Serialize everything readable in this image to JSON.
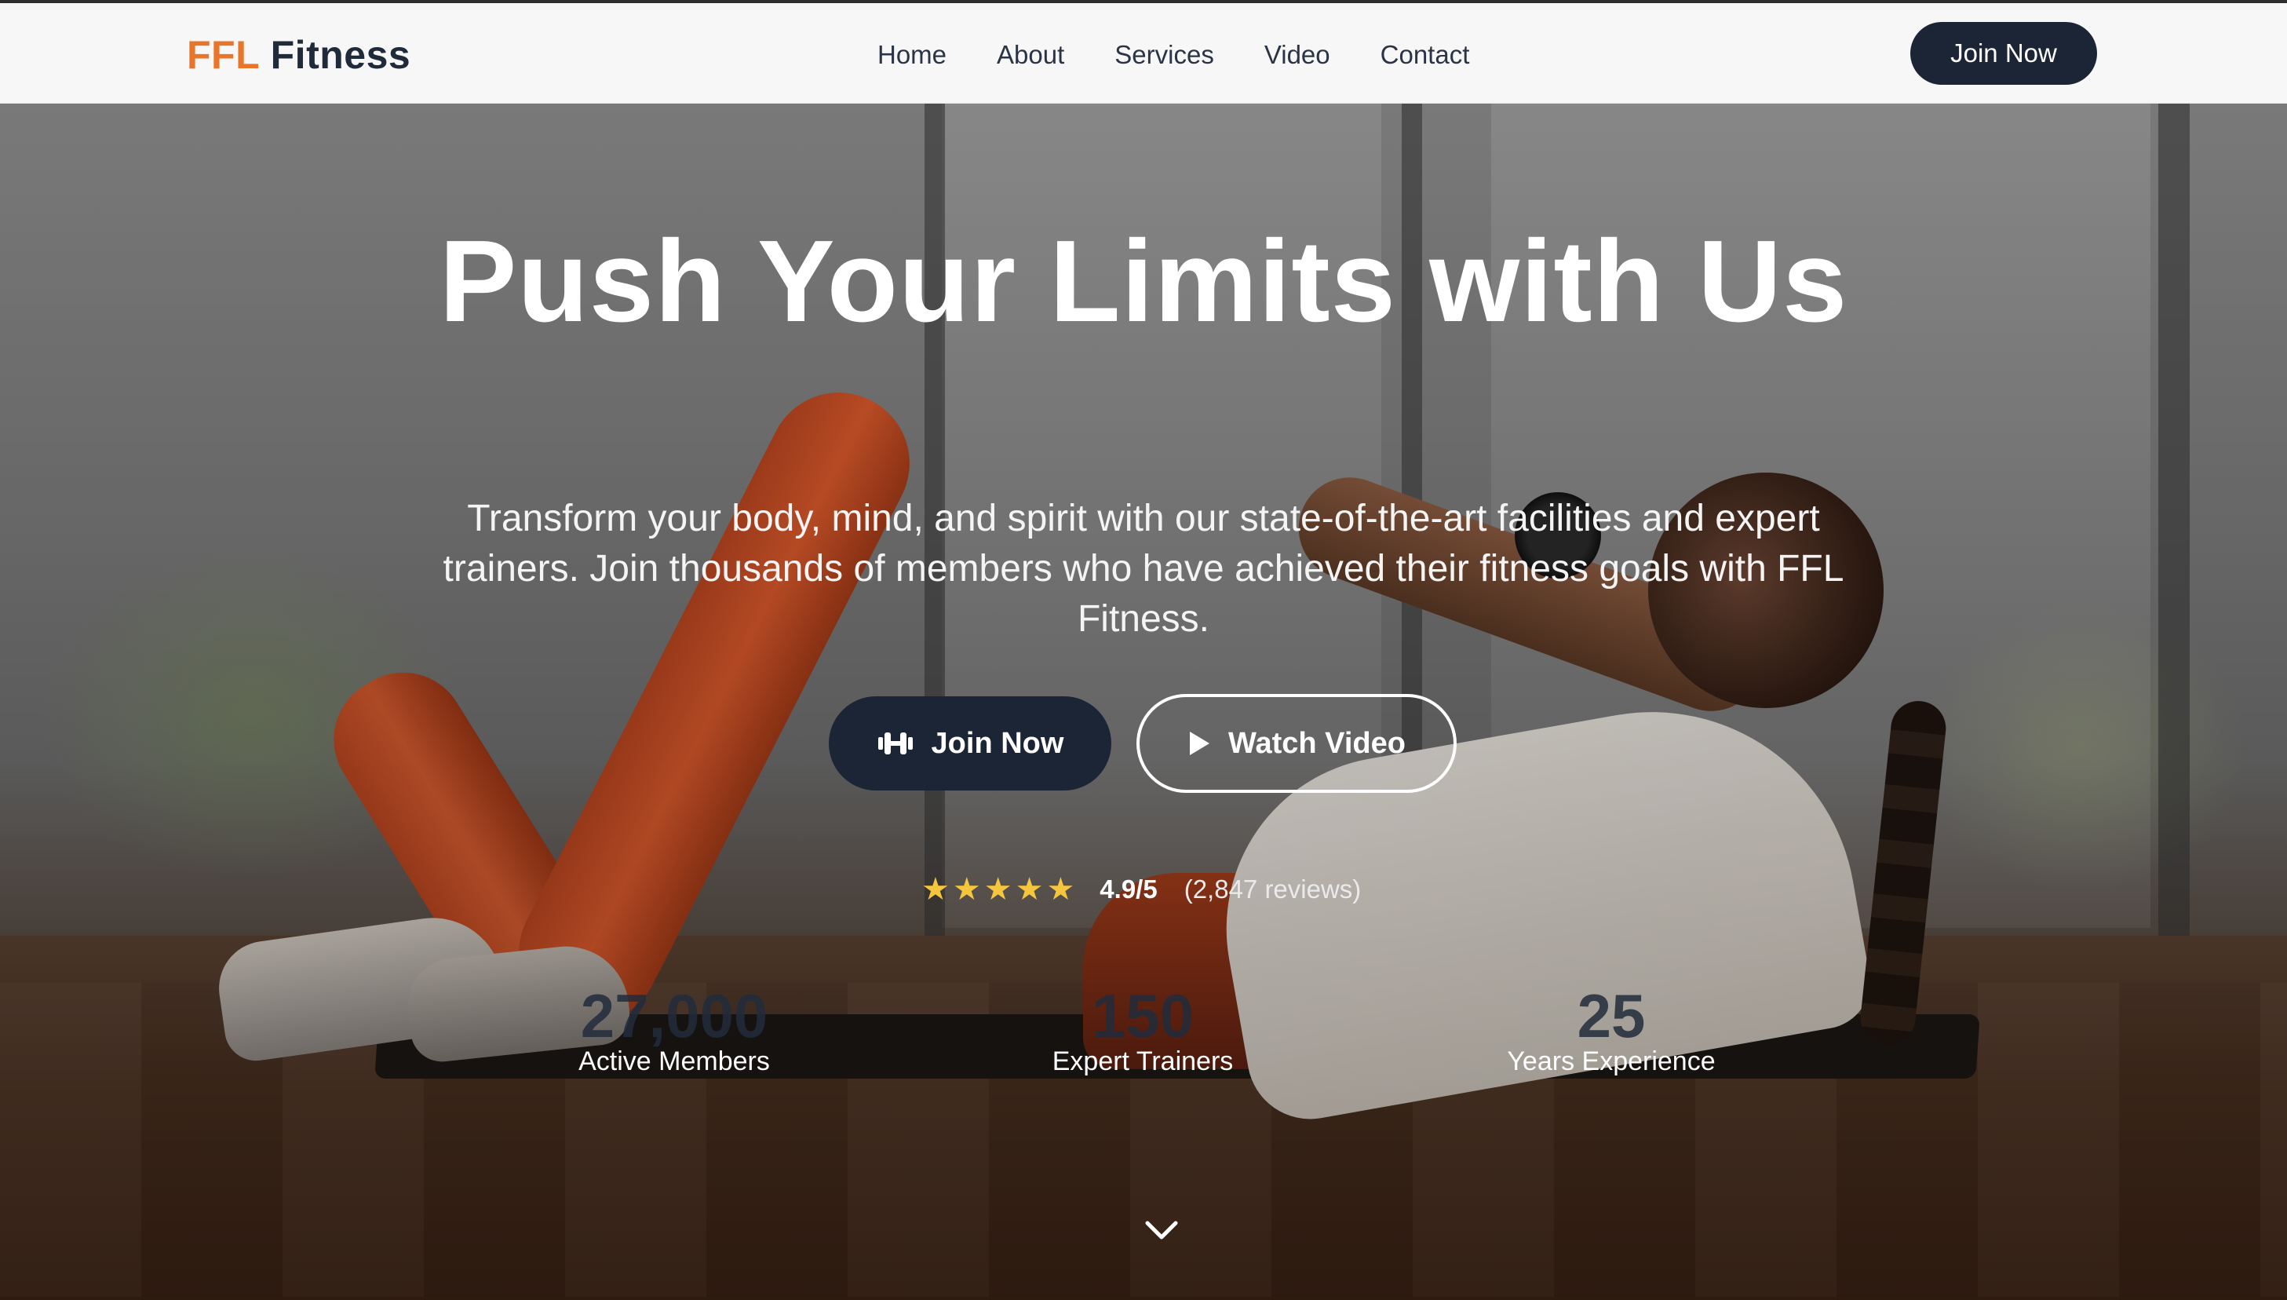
{
  "brand": {
    "accent_text": "FFL",
    "rest_text": "Fitness",
    "accent_color": "#e8752a",
    "text_color": "#1f2a3a"
  },
  "nav": {
    "links": [
      "Home",
      "About",
      "Services",
      "Video",
      "Contact"
    ],
    "cta_label": "Join Now"
  },
  "hero": {
    "title": "Push Your Limits with Us",
    "subtitle": "Transform your body, mind, and spirit with our state-of-the-art facilities and expert trainers. Join thousands of members who have achieved their fitness goals with FFL Fitness.",
    "primary_button": {
      "label": "Join Now",
      "icon": "dumbbell-icon"
    },
    "secondary_button": {
      "label": "Watch Video",
      "icon": "play-icon"
    },
    "rating": {
      "stars": 5,
      "score": "4.9/5",
      "count": "(2,847 reviews)",
      "star_color": "#f4c63d"
    },
    "stats": [
      {
        "value": "27,000",
        "label": "Active Members"
      },
      {
        "value": "150",
        "label": "Expert Trainers"
      },
      {
        "value": "25",
        "label": "Years Experience"
      }
    ],
    "scroll_icon": "chevron-down-icon"
  },
  "colors": {
    "button_dark": "#1c2535",
    "stat_value": "#222c3c"
  }
}
